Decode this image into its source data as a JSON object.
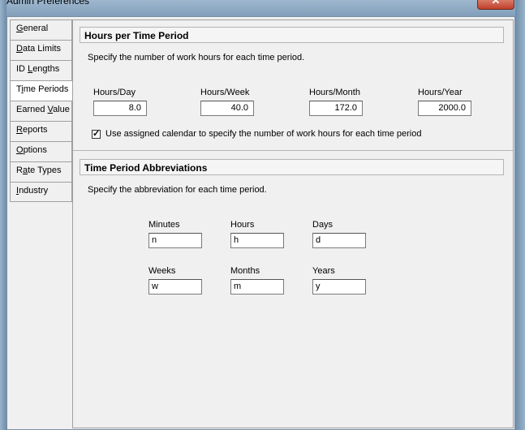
{
  "window": {
    "title": "Admin Preferences",
    "close_glyph": "✕"
  },
  "sidebar": {
    "items": [
      {
        "pre": "",
        "u": "G",
        "post": "eneral"
      },
      {
        "pre": "",
        "u": "D",
        "post": "ata Limits"
      },
      {
        "pre": "ID ",
        "u": "L",
        "post": "engths"
      },
      {
        "pre": "T",
        "u": "i",
        "post": "me Periods"
      },
      {
        "pre": "Earned ",
        "u": "V",
        "post": "alue"
      },
      {
        "pre": "",
        "u": "R",
        "post": "eports"
      },
      {
        "pre": "",
        "u": "O",
        "post": "ptions"
      },
      {
        "pre": "R",
        "u": "a",
        "post": "te Types"
      },
      {
        "pre": "",
        "u": "I",
        "post": "ndustry"
      }
    ],
    "active_index": 3
  },
  "hours": {
    "title": "Hours per Time Period",
    "description": "Specify the number of work hours for each time period.",
    "fields": [
      {
        "label": "Hours/Day",
        "value": "8.0"
      },
      {
        "label": "Hours/Week",
        "value": "40.0"
      },
      {
        "label": "Hours/Month",
        "value": "172.0"
      },
      {
        "label": "Hours/Year",
        "value": "2000.0"
      }
    ],
    "checkbox_label": "Use assigned calendar to specify the number of work hours for each time period",
    "checkbox_checked": true,
    "check_glyph": "✓"
  },
  "abbrev": {
    "title": "Time Period Abbreviations",
    "description": "Specify the abbreviation for each time period.",
    "fields": [
      {
        "label": "Minutes",
        "value": "n"
      },
      {
        "label": "Hours",
        "value": "h"
      },
      {
        "label": "Days",
        "value": "d"
      },
      {
        "label": "Weeks",
        "value": "w"
      },
      {
        "label": "Months",
        "value": "m"
      },
      {
        "label": "Years",
        "value": "y"
      }
    ]
  }
}
